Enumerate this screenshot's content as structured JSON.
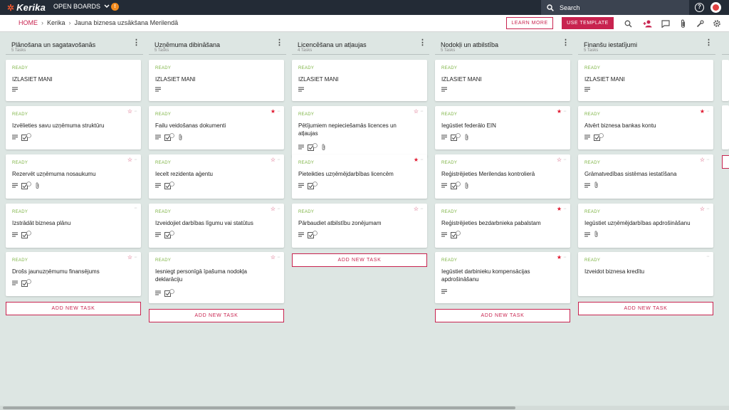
{
  "app": {
    "logo": "Kerika",
    "open_boards": "OPEN BOARDS",
    "badge": "!",
    "search_placeholder": "Search"
  },
  "breadcrumb": {
    "home": "HOME",
    "org": "Kerika",
    "board": "Jauna biznesa uzsākšana Merilendā"
  },
  "toolbar": {
    "learn_more": "LEARN MORE",
    "use_template": "USE TEMPLATE"
  },
  "add_task_label": "ADD NEW TASK",
  "colors": {
    "accent": "#c8234f",
    "ready": "#7cb342",
    "topbar": "#232b36"
  },
  "columns": [
    {
      "title": "Plānošana un sagatavošanās",
      "count": "5 Tasks",
      "cards": [
        {
          "status": "READY",
          "title": "IZLASIET MANI",
          "star": "none",
          "icons": [
            "desc"
          ]
        },
        {
          "status": "READY",
          "title": "Izvēlieties savu uzņēmuma struktūru",
          "star": "outline",
          "icons": [
            "desc",
            "check"
          ]
        },
        {
          "status": "READY",
          "title": "Rezervēt uzņēmuma nosaukumu",
          "star": "outline",
          "icons": [
            "desc",
            "check",
            "attach"
          ]
        },
        {
          "status": "READY",
          "title": "Izstrādāt biznesa plānu",
          "star": "none",
          "icons": [
            "desc",
            "check"
          ]
        },
        {
          "status": "READY",
          "title": "Drošs jaunuzņēmumu finansējums",
          "star": "outline",
          "icons": [
            "desc",
            "check"
          ]
        }
      ]
    },
    {
      "title": "Uzņēmuma dibināšana",
      "count": "5 Tasks",
      "cards": [
        {
          "status": "READY",
          "title": "IZLASIET MANI",
          "star": "none",
          "icons": [
            "desc"
          ]
        },
        {
          "status": "READY",
          "title": "Failu veidošanas dokumenti",
          "star": "filled",
          "icons": [
            "desc",
            "check",
            "attach"
          ]
        },
        {
          "status": "READY",
          "title": "Iecelt rezidenta aģentu",
          "star": "outline",
          "icons": [
            "desc",
            "check"
          ]
        },
        {
          "status": "READY",
          "title": "Izveidojiet darbības līgumu vai statūtus",
          "star": "outline",
          "icons": [
            "desc",
            "check"
          ]
        },
        {
          "status": "READY",
          "title": "Iesniegt personīgā īpašuma nodokļa deklarāciju",
          "star": "outline",
          "icons": [
            "desc",
            "check"
          ]
        }
      ]
    },
    {
      "title": "Licencēšana un atļaujas",
      "count": "4 Tasks",
      "cards": [
        {
          "status": "READY",
          "title": "IZLASIET MANI",
          "star": "none",
          "icons": [
            "desc"
          ]
        },
        {
          "status": "READY",
          "title": "Pētījumiem nepieciešamās licences un atļaujas",
          "star": "outline",
          "icons": [
            "desc",
            "check",
            "attach"
          ]
        },
        {
          "status": "READY",
          "title": "Pieteikties uzņēmējdarbības licencēm",
          "star": "filled",
          "icons": [
            "desc",
            "check"
          ]
        },
        {
          "status": "READY",
          "title": "Pārbaudiet atbilstību zonējumam",
          "star": "outline",
          "icons": [
            "desc",
            "check"
          ]
        }
      ]
    },
    {
      "title": "Nodokļi un atbilstība",
      "count": "5 Tasks",
      "cards": [
        {
          "status": "READY",
          "title": "IZLASIET MANI",
          "star": "none",
          "icons": [
            "desc"
          ]
        },
        {
          "status": "READY",
          "title": "Iegūstiet federālo EIN",
          "star": "filled",
          "icons": [
            "desc",
            "check",
            "attach"
          ]
        },
        {
          "status": "READY",
          "title": "Reģistrējieties Merilendas kontrolierā",
          "star": "outline",
          "icons": [
            "desc",
            "check",
            "attach"
          ]
        },
        {
          "status": "READY",
          "title": "Reģistrējieties bezdarbnieka pabalstam",
          "star": "filled",
          "icons": [
            "desc",
            "check"
          ]
        },
        {
          "status": "READY",
          "title": "Iegūstiet darbinieku kompensācijas apdrošināšanu",
          "star": "filled",
          "icons": [
            "desc"
          ]
        }
      ]
    },
    {
      "title": "Finanšu iestatījumi",
      "count": "5 Tasks",
      "cards": [
        {
          "status": "READY",
          "title": "IZLASIET MANI",
          "star": "none",
          "icons": [
            "desc"
          ]
        },
        {
          "status": "READY",
          "title": "Atvērt biznesa bankas kontu",
          "star": "filled",
          "icons": [
            "desc",
            "check"
          ]
        },
        {
          "status": "READY",
          "title": "Grāmatvedības sistēmas iestatīšana",
          "star": "outline",
          "icons": [
            "desc",
            "attach"
          ]
        },
        {
          "status": "READY",
          "title": "Iegūstiet uzņēmējdarbības apdrošināšanu",
          "star": "outline",
          "icons": [
            "desc",
            "attach"
          ]
        },
        {
          "status": "READY",
          "title": "Izveidot biznesa kredītu",
          "star": "none",
          "icons": []
        }
      ]
    }
  ]
}
